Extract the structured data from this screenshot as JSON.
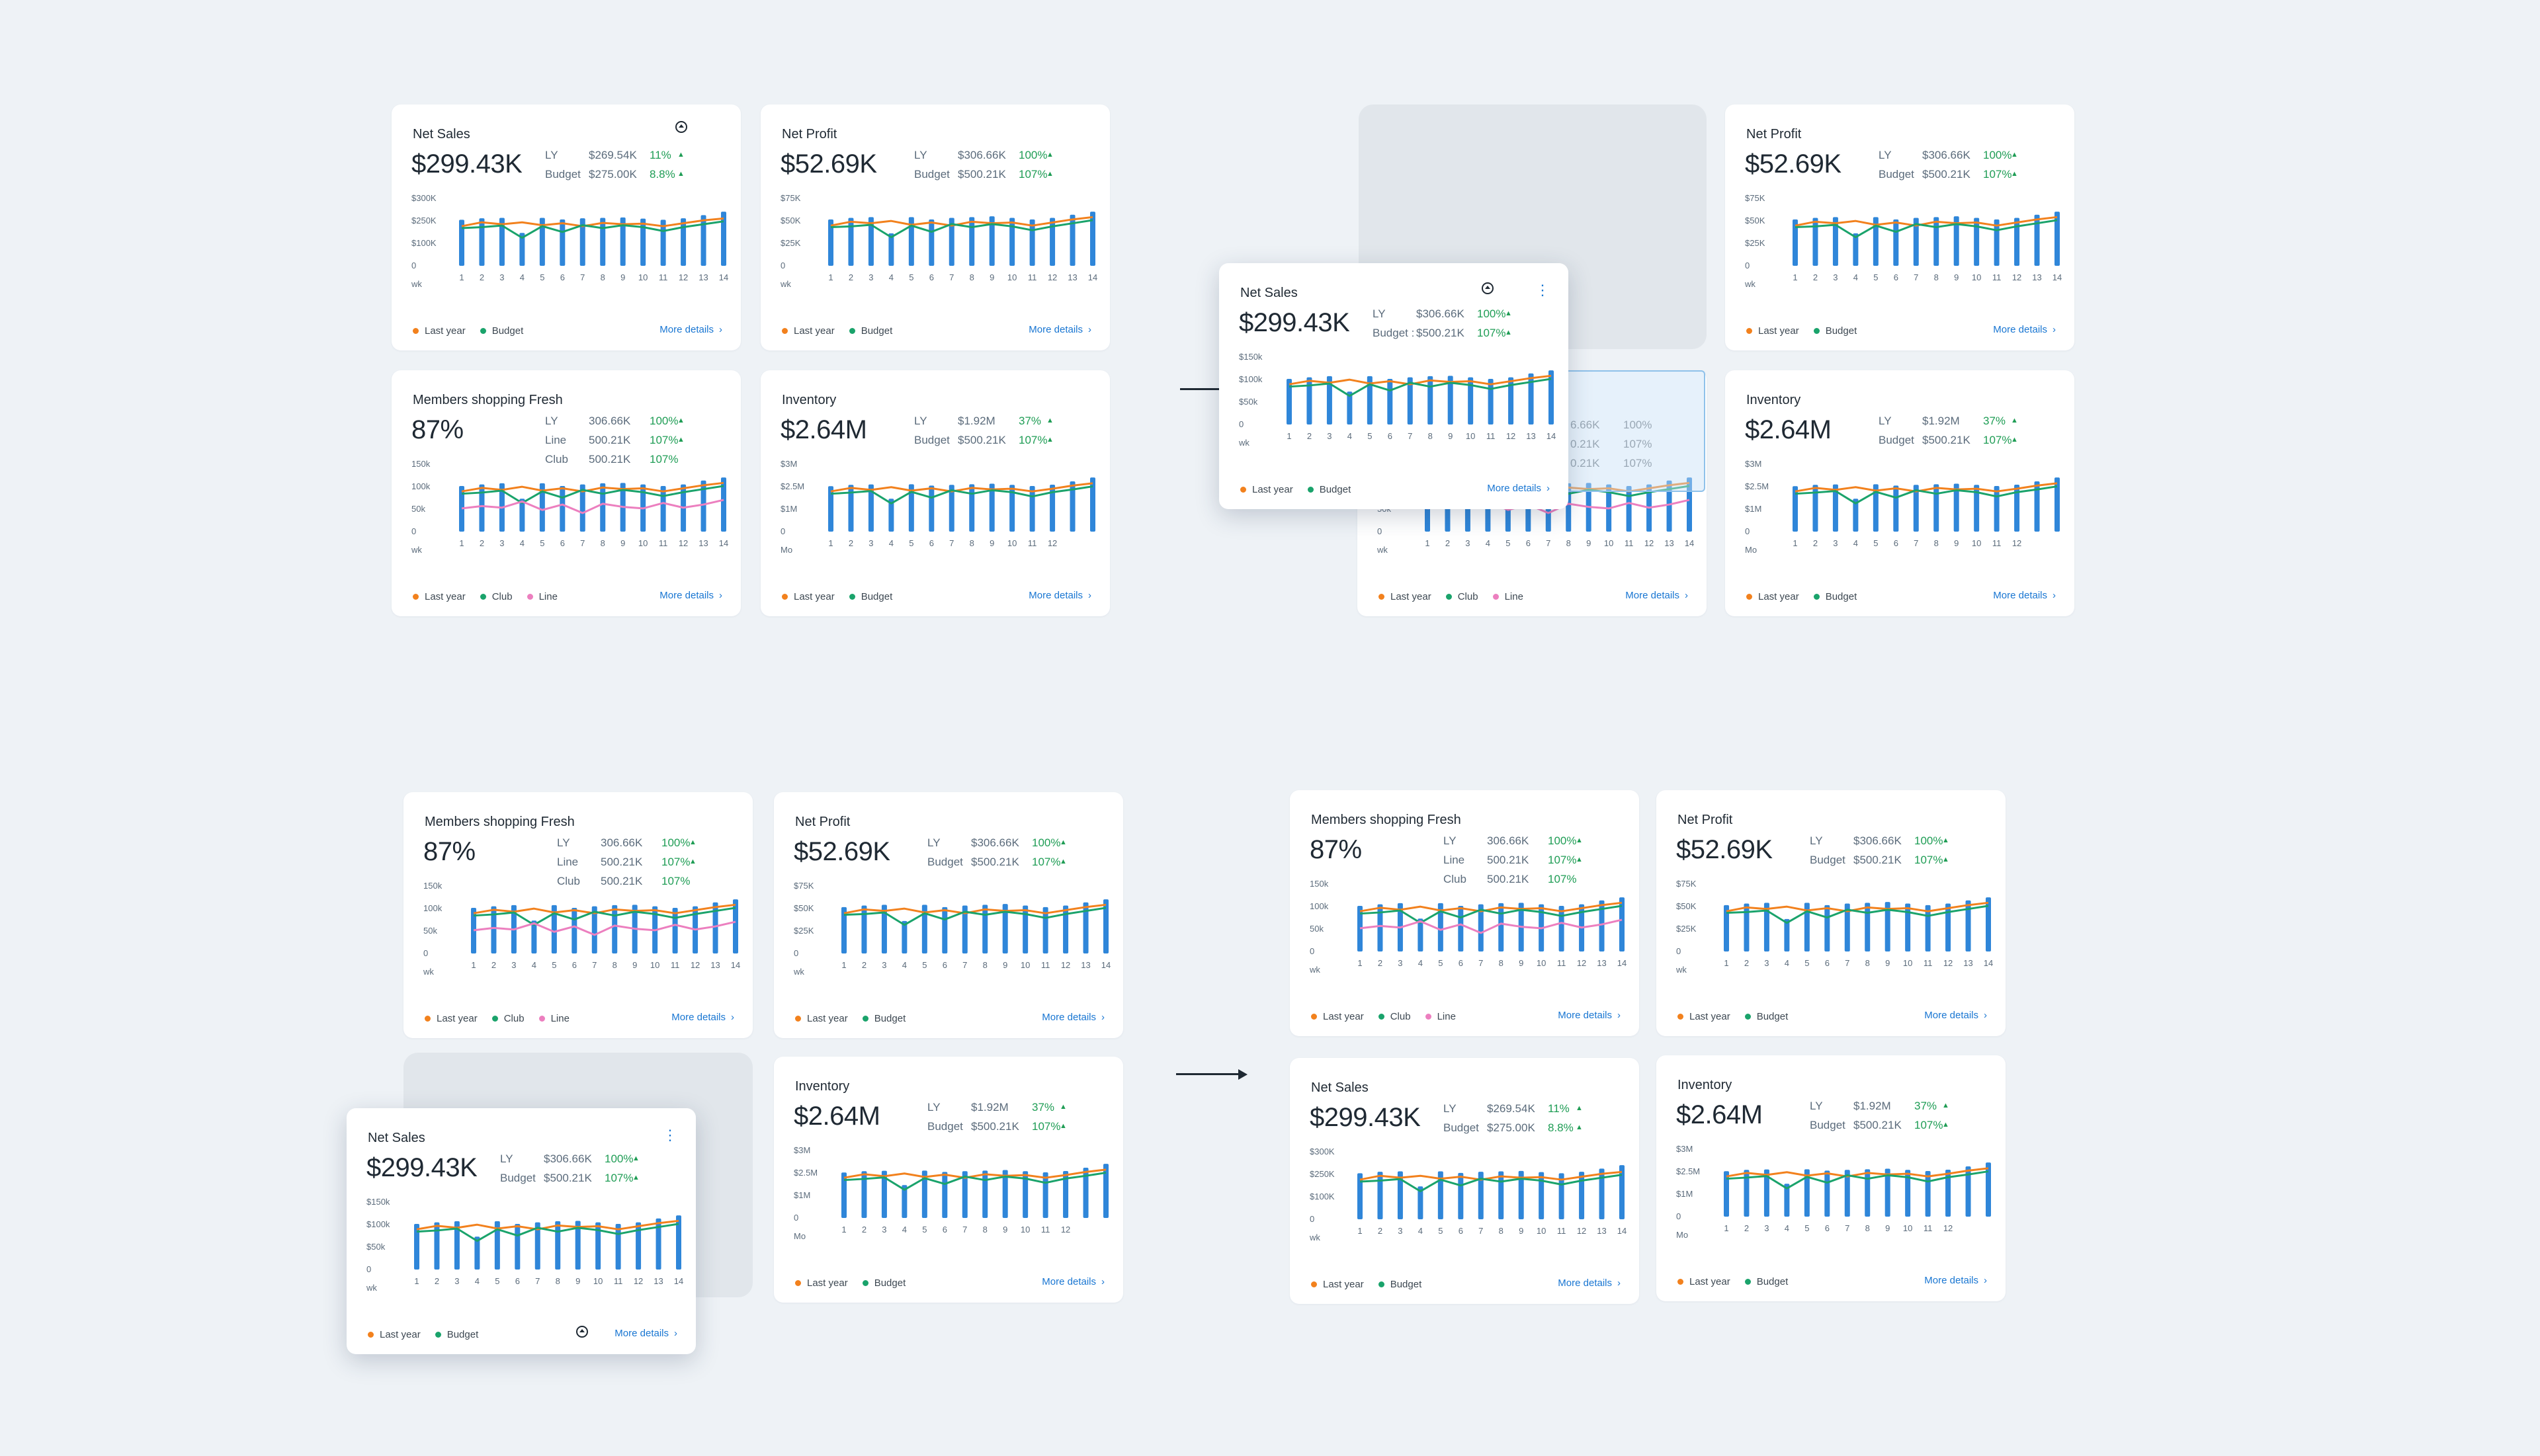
{
  "legend_labels": {
    "last_year": "Last year",
    "budget": "Budget",
    "club": "Club",
    "line": "Line"
  },
  "more_details": "More details",
  "colors": {
    "bar": "#2f86d9",
    "last_year": "#f2811d",
    "budget": "#1aa36b",
    "line": "#ec7fbf",
    "positive": "#1f9d55",
    "link": "#1976d2"
  },
  "icons": {
    "kebab": "more-vertical-icon",
    "cursor": "grab-cursor-icon",
    "chevron": "chevron-right-icon"
  },
  "ghost": {
    "rows": [
      {
        "num": "6.66K",
        "pct": "100%"
      },
      {
        "num": "0.21K",
        "pct": "107%"
      },
      {
        "num": "0.21K",
        "pct": "107%"
      }
    ]
  },
  "cards": [
    {
      "title": "Net Sales",
      "value": "$299.43K",
      "stats": [
        {
          "label": "LY",
          "num": "$269.54K",
          "pct": "11%"
        },
        {
          "label": "Budget",
          "num": "$275.00K",
          "pct": "8.8%"
        }
      ],
      "chart": "sales",
      "legend": "lb",
      "cursor": true
    },
    {
      "title": "Net Profit",
      "value": "$52.69K",
      "stats": [
        {
          "label": "LY",
          "num": "$306.66K",
          "pct": "100%"
        },
        {
          "label": "Budget",
          "num": "$500.21K",
          "pct": "107%"
        }
      ],
      "chart": "profit",
      "legend": "lb"
    },
    {
      "title": "Members shopping Fresh",
      "value": "87%",
      "stats": [
        {
          "label": "LY",
          "num": "306.66K",
          "pct": "100%"
        },
        {
          "label": "Line",
          "num": "500.21K",
          "pct": "107%"
        },
        {
          "label": "Club",
          "num": "500.21K",
          "pct": "107%",
          "notri": true
        }
      ],
      "chart": "members",
      "legend": "lcl"
    },
    {
      "title": "Inventory",
      "value": "$2.64M",
      "stats": [
        {
          "label": "LY",
          "num": "$1.92M",
          "pct": "37%"
        },
        {
          "label": "Budget",
          "num": "$500.21K",
          "pct": "107%"
        }
      ],
      "chart": "inventory",
      "legend": "lb"
    },
    {
      "title": "Net Sales",
      "value": "$299.43K",
      "stats": [
        {
          "label": "LY",
          "num": "$306.66K",
          "pct": "100%"
        },
        {
          "label": "Budget : ",
          "num": "$500.21K",
          "pct": "107%"
        }
      ],
      "chart": "sales2",
      "legend": "lb",
      "kebab": true,
      "cursor": true
    },
    {
      "title": "Net Profit",
      "value": "$52.69K",
      "stats": [
        {
          "label": "LY",
          "num": "$306.66K",
          "pct": "100%"
        },
        {
          "label": "Budget",
          "num": "$500.21K",
          "pct": "107%"
        }
      ],
      "chart": "profit",
      "legend": "lb"
    },
    {
      "title": "",
      "value": "",
      "stats": [],
      "chart": "members",
      "legend": "lcl"
    },
    {
      "title": "Inventory",
      "value": "$2.64M",
      "stats": [
        {
          "label": "LY",
          "num": "$1.92M",
          "pct": "37%"
        },
        {
          "label": "Budget",
          "num": "$500.21K",
          "pct": "107%"
        }
      ],
      "chart": "inventory",
      "legend": "lb"
    },
    {
      "title": "Members shopping Fresh",
      "value": "87%",
      "stats": [
        {
          "label": "LY",
          "num": "306.66K",
          "pct": "100%"
        },
        {
          "label": "Line",
          "num": "500.21K",
          "pct": "107%"
        },
        {
          "label": "Club",
          "num": "500.21K",
          "pct": "107%",
          "notri": true
        }
      ],
      "chart": "members",
      "legend": "lcl"
    },
    {
      "title": "Net Profit",
      "value": "$52.69K",
      "stats": [
        {
          "label": "LY",
          "num": "$306.66K",
          "pct": "100%"
        },
        {
          "label": "Budget",
          "num": "$500.21K",
          "pct": "107%"
        }
      ],
      "chart": "profit",
      "legend": "lb"
    },
    {
      "title": "Net Sales",
      "value": "$299.43K",
      "stats": [
        {
          "label": "LY",
          "num": "$306.66K",
          "pct": "100%"
        },
        {
          "label": "Budget",
          "num": "$500.21K",
          "pct": "107%"
        }
      ],
      "chart": "sales2",
      "legend": "lb",
      "kebab": true,
      "cursor": true
    },
    {
      "title": "Inventory",
      "value": "$2.64M",
      "stats": [
        {
          "label": "LY",
          "num": "$1.92M",
          "pct": "37%"
        },
        {
          "label": "Budget",
          "num": "$500.21K",
          "pct": "107%"
        }
      ],
      "chart": "inventory",
      "legend": "lb"
    },
    {
      "title": "Members shopping Fresh",
      "value": "87%",
      "stats": [
        {
          "label": "LY",
          "num": "306.66K",
          "pct": "100%"
        },
        {
          "label": "Line",
          "num": "500.21K",
          "pct": "107%"
        },
        {
          "label": "Club",
          "num": "500.21K",
          "pct": "107%",
          "notri": true
        }
      ],
      "chart": "members",
      "legend": "lcl"
    },
    {
      "title": "Net Profit",
      "value": "$52.69K",
      "stats": [
        {
          "label": "LY",
          "num": "$306.66K",
          "pct": "100%"
        },
        {
          "label": "Budget",
          "num": "$500.21K",
          "pct": "107%"
        }
      ],
      "chart": "profit",
      "legend": "lb"
    },
    {
      "title": "Net Sales",
      "value": "$299.43K",
      "stats": [
        {
          "label": "LY",
          "num": "$269.54K",
          "pct": "11%"
        },
        {
          "label": "Budget",
          "num": "$275.00K",
          "pct": "8.8%"
        }
      ],
      "chart": "sales",
      "legend": "lb"
    },
    {
      "title": "Inventory",
      "value": "$2.64M",
      "stats": [
        {
          "label": "LY",
          "num": "$1.92M",
          "pct": "37%"
        },
        {
          "label": "Budget",
          "num": "$500.21K",
          "pct": "107%"
        }
      ],
      "chart": "inventory",
      "legend": "lb"
    }
  ],
  "chart_data": [
    {
      "id": "sales",
      "type": "bar",
      "title": "Net Sales",
      "xlabel": "wk",
      "y_ticks": [
        "$300K",
        "$250K",
        "$100K",
        "0"
      ],
      "ylim": [
        0,
        300000
      ],
      "categories": [
        "1",
        "2",
        "3",
        "4",
        "5",
        "6",
        "7",
        "8",
        "9",
        "10",
        "11",
        "12",
        "13",
        "14"
      ],
      "series": [
        {
          "name": "Net Sales",
          "values": [
            238000,
            246000,
            248000,
            170000,
            248000,
            240000,
            246000,
            248000,
            250000,
            244000,
            238000,
            246000,
            262000,
            280000
          ]
        },
        {
          "name": "Last year",
          "values": [
            205000,
            225000,
            215000,
            225000,
            210000,
            220000,
            205000,
            222000,
            215000,
            218000,
            205000,
            220000,
            235000,
            245000
          ]
        },
        {
          "name": "Budget",
          "values": [
            195000,
            200000,
            208000,
            145000,
            205000,
            175000,
            210000,
            195000,
            210000,
            200000,
            180000,
            200000,
            215000,
            230000
          ]
        }
      ]
    },
    {
      "id": "profit",
      "type": "bar",
      "title": "Net Profit",
      "xlabel": "wk",
      "y_ticks": [
        "$75K",
        "$50K",
        "$25K",
        "0"
      ],
      "ylim": [
        0,
        75000
      ],
      "categories": [
        "1",
        "2",
        "3",
        "4",
        "5",
        "6",
        "7",
        "8",
        "9",
        "10",
        "11",
        "12",
        "13",
        "14"
      ],
      "series": [
        {
          "name": "Net Profit",
          "values": [
            60000,
            62000,
            63000,
            42000,
            63000,
            60000,
            62000,
            63000,
            64000,
            62000,
            60000,
            62000,
            66000,
            70000
          ]
        },
        {
          "name": "Last year",
          "values": [
            52000,
            57000,
            55000,
            58000,
            53000,
            56000,
            52000,
            57000,
            55000,
            56000,
            52000,
            56000,
            60000,
            63000
          ]
        },
        {
          "name": "Budget",
          "values": [
            50000,
            51000,
            53000,
            37000,
            52000,
            44000,
            54000,
            50000,
            54000,
            51000,
            46000,
            51000,
            55000,
            59000
          ]
        }
      ]
    },
    {
      "id": "members",
      "type": "bar",
      "title": "Members shopping Fresh",
      "xlabel": "wk",
      "y_ticks": [
        "150k",
        "100k",
        "50k",
        "0"
      ],
      "ylim": [
        0,
        150000
      ],
      "categories": [
        "1",
        "2",
        "3",
        "4",
        "5",
        "6",
        "7",
        "8",
        "9",
        "10",
        "11",
        "12",
        "13",
        "14"
      ],
      "series": [
        {
          "name": "Members",
          "values": [
            118000,
            122000,
            125000,
            85000,
            125000,
            118000,
            122000,
            125000,
            126000,
            122000,
            118000,
            122000,
            132000,
            140000
          ]
        },
        {
          "name": "Last year",
          "values": [
            104000,
            113000,
            108000,
            116000,
            106000,
            112000,
            104000,
            114000,
            110000,
            112000,
            104000,
            112000,
            120000,
            126000
          ]
        },
        {
          "name": "Club",
          "values": [
            98000,
            101000,
            106000,
            74000,
            104000,
            88000,
            108000,
            98000,
            108000,
            102000,
            92000,
            102000,
            110000,
            118000
          ]
        },
        {
          "name": "Line",
          "values": [
            60000,
            66000,
            62000,
            78000,
            56000,
            70000,
            48000,
            72000,
            64000,
            60000,
            74000,
            62000,
            70000,
            82000
          ]
        }
      ]
    },
    {
      "id": "inventory",
      "type": "bar",
      "title": "Inventory",
      "xlabel": "Mo",
      "y_ticks": [
        "$3M",
        "$2.5M",
        "$1M",
        "0"
      ],
      "ylim": [
        0,
        3000000
      ],
      "categories": [
        "1",
        "2",
        "3",
        "4",
        "5",
        "6",
        "7",
        "8",
        "9",
        "10",
        "11",
        "12"
      ],
      "series": [
        {
          "name": "Inventory",
          "values": [
            2350000,
            2420000,
            2440000,
            1700000,
            2450000,
            2380000,
            2420000,
            2450000,
            2480000,
            2420000,
            2360000,
            2430000,
            2600000,
            2800000
          ]
        },
        {
          "name": "Last year",
          "values": [
            2080000,
            2260000,
            2160000,
            2300000,
            2120000,
            2240000,
            2080000,
            2260000,
            2180000,
            2220000,
            2080000,
            2220000,
            2380000,
            2500000
          ]
        },
        {
          "name": "Budget",
          "values": [
            1960000,
            2020000,
            2100000,
            1460000,
            2060000,
            1760000,
            2140000,
            1960000,
            2140000,
            2040000,
            1820000,
            2040000,
            2180000,
            2340000
          ]
        }
      ]
    },
    {
      "id": "sales2",
      "type": "bar",
      "title": "Net Sales",
      "xlabel": "wk",
      "y_ticks": [
        "$150k",
        "$100k",
        "$50k",
        "0"
      ],
      "ylim": [
        0,
        150000
      ],
      "categories": [
        "1",
        "2",
        "3",
        "4",
        "5",
        "6",
        "7",
        "8",
        "9",
        "10",
        "11",
        "12",
        "13",
        "14"
      ],
      "series": [
        {
          "name": "Net Sales",
          "values": [
            118000,
            122000,
            125000,
            85000,
            125000,
            118000,
            122000,
            125000,
            126000,
            122000,
            118000,
            122000,
            132000,
            140000
          ]
        },
        {
          "name": "Last year",
          "values": [
            104000,
            113000,
            108000,
            116000,
            106000,
            112000,
            104000,
            114000,
            110000,
            112000,
            104000,
            112000,
            120000,
            126000
          ]
        },
        {
          "name": "Budget",
          "values": [
            98000,
            101000,
            106000,
            74000,
            104000,
            88000,
            108000,
            98000,
            108000,
            102000,
            92000,
            102000,
            110000,
            118000
          ]
        }
      ]
    }
  ]
}
